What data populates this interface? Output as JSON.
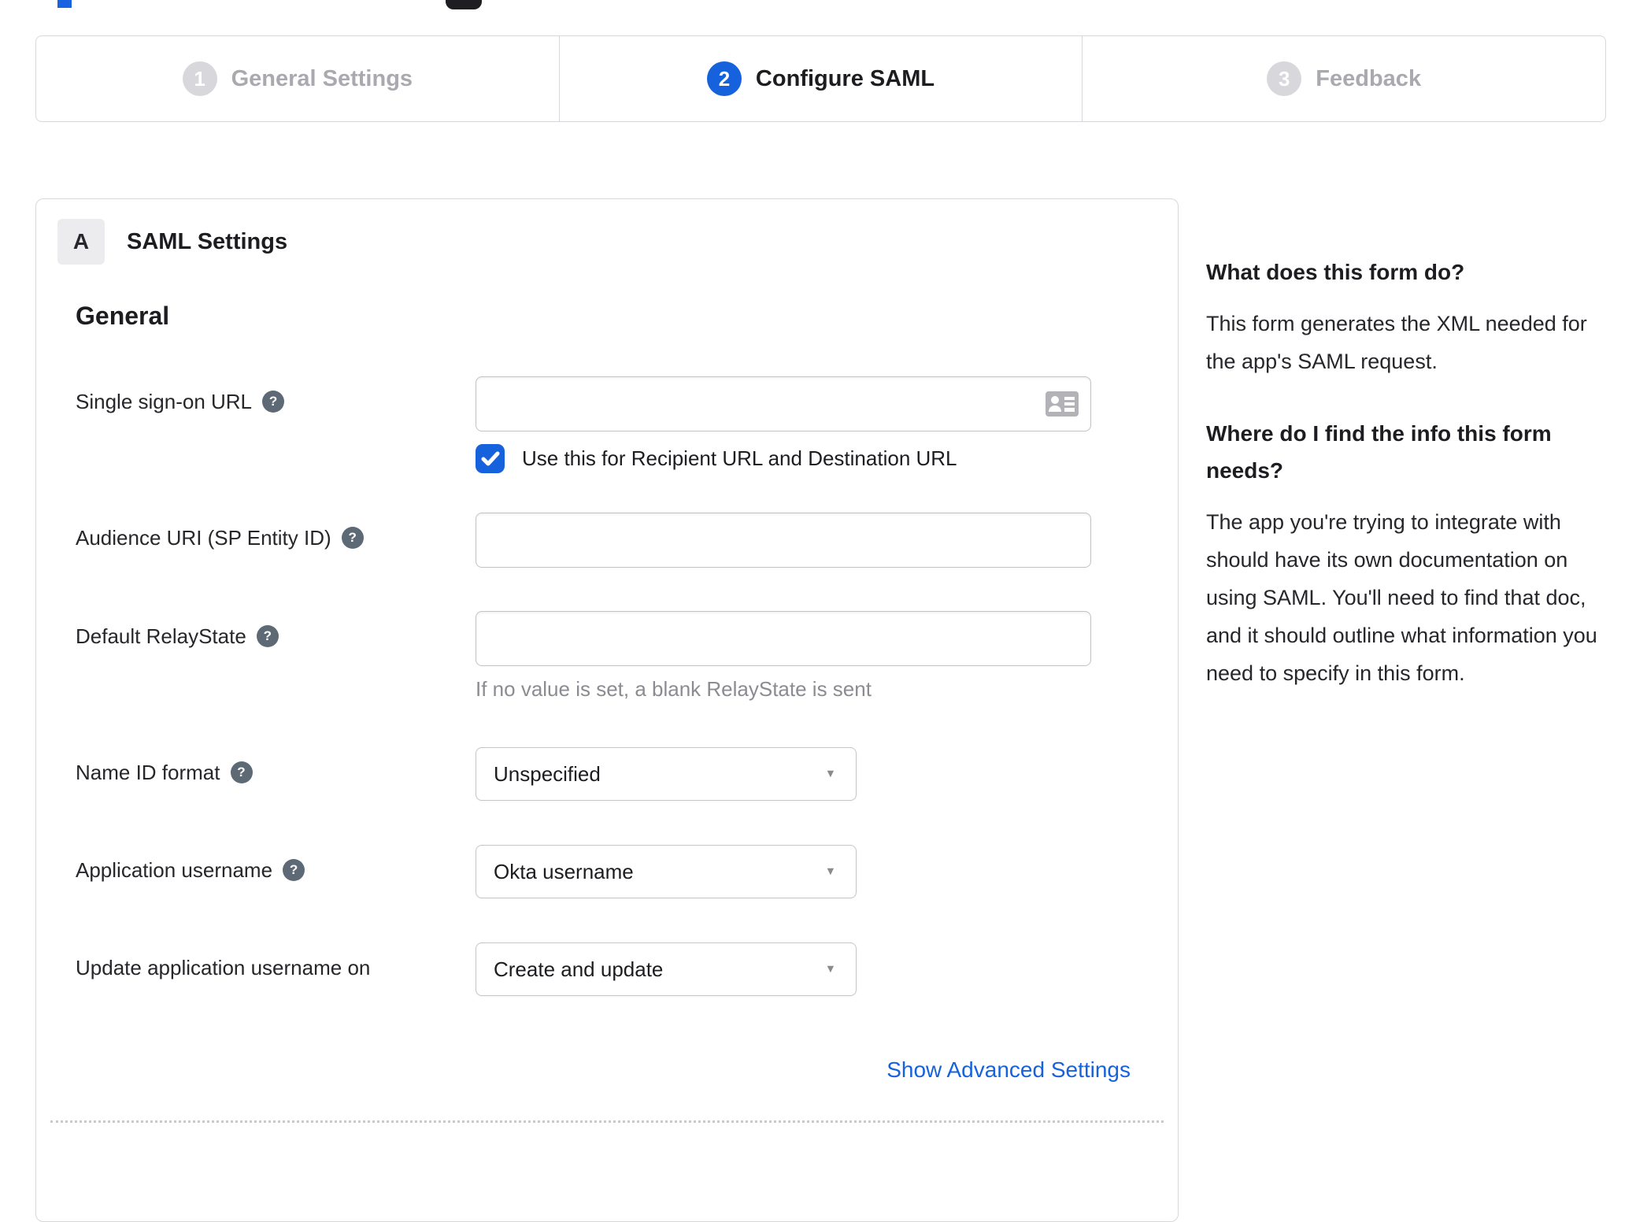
{
  "stepper": {
    "steps": [
      {
        "number": "1",
        "label": "General Settings",
        "state": "inactive"
      },
      {
        "number": "2",
        "label": "Configure SAML",
        "state": "active"
      },
      {
        "number": "3",
        "label": "Feedback",
        "state": "inactive"
      }
    ]
  },
  "panel": {
    "section_badge": "A",
    "section_title": "SAML Settings",
    "group_heading": "General",
    "fields": {
      "sso_url": {
        "label": "Single sign-on URL",
        "value": "",
        "checkbox_label": "Use this for Recipient URL and Destination URL",
        "checkbox_checked": true
      },
      "audience_uri": {
        "label": "Audience URI (SP Entity ID)",
        "value": ""
      },
      "relay_state": {
        "label": "Default RelayState",
        "value": "",
        "hint": "If no value is set, a blank RelayState is sent"
      },
      "name_id_format": {
        "label": "Name ID format",
        "value": "Unspecified"
      },
      "app_username": {
        "label": "Application username",
        "value": "Okta username"
      },
      "update_app_username": {
        "label": "Update application username on",
        "value": "Create and update"
      }
    },
    "advanced_link": "Show Advanced Settings"
  },
  "sidebar": {
    "sections": [
      {
        "heading": "What does this form do?",
        "body": "This form generates the XML needed for the app's SAML request."
      },
      {
        "heading": "Where do I find the info this form needs?",
        "body": "The app you're trying to integrate with should have its own documentation on using SAML. You'll need to find that doc, and it should outline what information you need to specify in this form."
      }
    ]
  },
  "icons": {
    "help_glyph": "?",
    "select_arrow_glyph": "▼"
  },
  "colors": {
    "accent_blue": "#1662dd",
    "inactive_gray": "#a9a9af",
    "border_gray": "#d8d8dc",
    "hint_gray": "#8b8b92",
    "help_icon_bg": "#5d6a75"
  }
}
